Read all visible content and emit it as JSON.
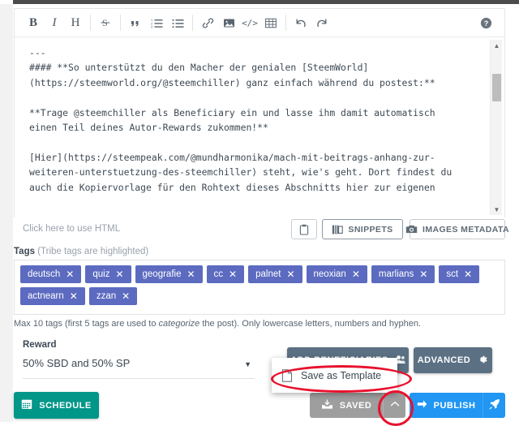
{
  "app": {
    "name": "steempeak-post-editor"
  },
  "toolbar": {
    "items": [
      {
        "name": "bold",
        "glyph": "B",
        "title": "Bold"
      },
      {
        "name": "italic",
        "glyph": "I",
        "title": "Italic"
      },
      {
        "name": "heading",
        "glyph": "H",
        "title": "Heading"
      },
      {
        "name": "strikethrough",
        "glyph": "S",
        "title": "Strikethrough"
      },
      {
        "name": "blockquote",
        "glyph": "“",
        "title": "Quote"
      },
      {
        "name": "ordered-list",
        "glyph": "",
        "title": "Numbered list"
      },
      {
        "name": "unordered-list",
        "glyph": "",
        "title": "Bullet list"
      },
      {
        "name": "link",
        "glyph": "",
        "title": "Link"
      },
      {
        "name": "image",
        "glyph": "",
        "title": "Image"
      },
      {
        "name": "code",
        "glyph": "</>",
        "title": "Code"
      },
      {
        "name": "table",
        "glyph": "",
        "title": "Table"
      },
      {
        "name": "undo",
        "glyph": "↺",
        "title": "Undo"
      },
      {
        "name": "redo",
        "glyph": "↻",
        "title": "Redo"
      }
    ],
    "help_label": "?"
  },
  "editor": {
    "content": "---\n#### **So unterstützt du den Macher der genialen [SteemWorld]\n(https://steemworld.org/@steemchiller) ganz einfach während du postest:**\n\n**Trage @steemchiller als Beneficiary ein und lasse ihm damit automatisch\neinen Teil deines Autor-Rewards zukommen!**\n\n[Hier](https://steempeak.com/@mundharmonika/mach-mit-beitrags-anhang-zur-\nweiteren-unterstuetzung-des-steemchiller) steht, wie's geht. Dort findest du\nauch die Kopiervorlage für den Rohtext dieses Abschnitts hier zur eigenen"
  },
  "under_editor": {
    "html_hint": "Click here to use HTML",
    "clipboard_label": "",
    "snippets_label": "SNIPPETS",
    "images_metadata_label": "IMAGES METADATA"
  },
  "tags": {
    "label": "Tags",
    "label_sub": "(Tribe tags are highlighted)",
    "items": [
      "deutsch",
      "quiz",
      "geografie",
      "cc",
      "palnet",
      "neoxian",
      "marlians",
      "sct",
      "actnearn",
      "zzan"
    ],
    "remove_glyph": "✕",
    "help_prefix": "Max 10 tags (first 5 tags are used to ",
    "help_italic": "categorize",
    "help_suffix": " the post). Only lowercase letters, numbers and hyphen.",
    "color": "#5c6bc0"
  },
  "reward": {
    "label": "Reward",
    "value": "50% SBD and 50% SP",
    "caret": "▼"
  },
  "actions": {
    "add_beneficiaries_label": "ADD BENEFICIARIES",
    "advanced_label": "ADVANCED",
    "schedule_label": "SCHEDULE",
    "saved_label": "SAVED",
    "saved_caret": "⌃",
    "publish_label": "PUBLISH",
    "slate_color": "#5b7183",
    "teal_color": "#009688",
    "grey_color": "#9e9e9e",
    "blue_color": "#2196f3"
  },
  "popup": {
    "save_as_template_label": "Save as Template"
  },
  "annotations": {
    "highlight_color": "#e8112d",
    "oval_template_target": "Save as Template",
    "oval_caret_target": "saved-dropdown-caret"
  }
}
